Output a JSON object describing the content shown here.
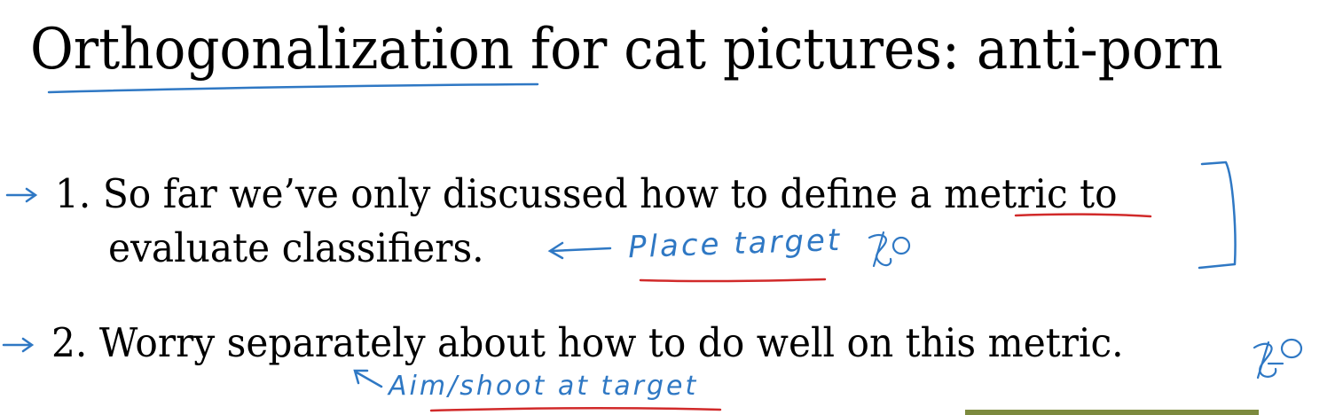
{
  "slide": {
    "title": "Orthogonalization for cat pictures: anti-porn",
    "bullets": [
      {
        "number": "1.",
        "line1_before": "So far we’ve only discussed how to define a ",
        "line1_emphasis": "metric",
        "line1_after": " to",
        "line2": "evaluate classifiers."
      },
      {
        "number": "2.",
        "line1": "Worry separately about how to do well on this metric."
      }
    ]
  },
  "annotations": {
    "note_place_target": "Place target",
    "note_aim_shoot": "Aim/shoot at target"
  },
  "colors": {
    "ink_blue": "#2f78c4",
    "ink_red": "#d12a2a",
    "text": "#000000",
    "background": "#ffffff"
  }
}
